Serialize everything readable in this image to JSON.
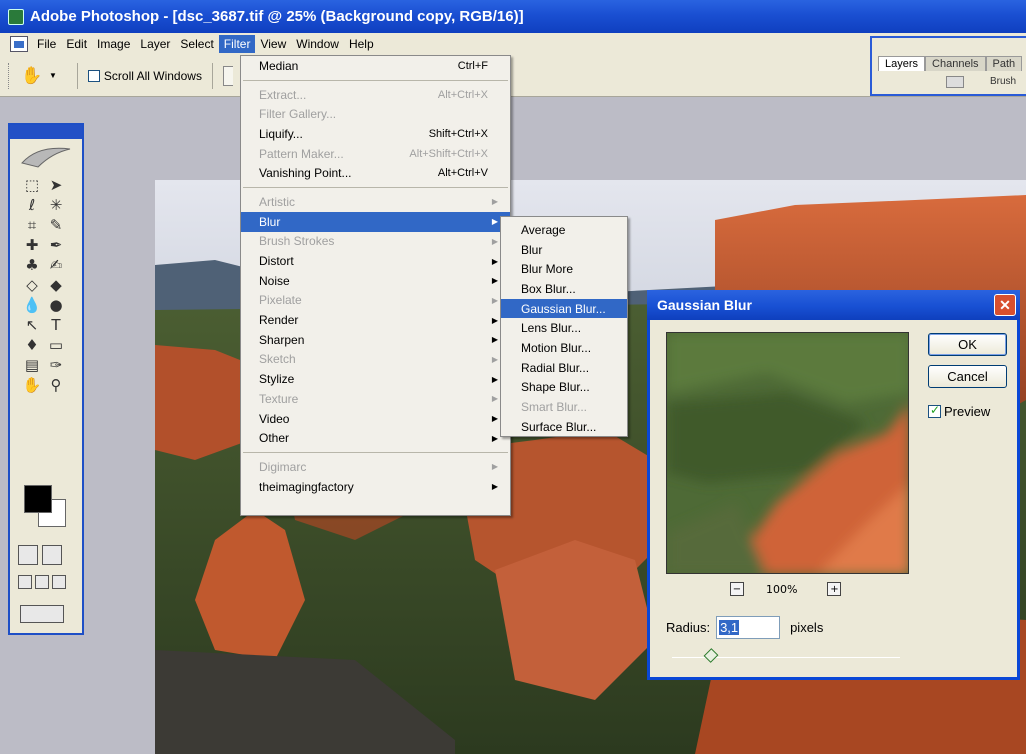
{
  "window": {
    "title": "Adobe Photoshop - [dsc_3687.tif @ 25% (Background copy, RGB/16)]"
  },
  "menubar": {
    "items": [
      "File",
      "Edit",
      "Image",
      "Layer",
      "Select",
      "Filter",
      "View",
      "Window",
      "Help"
    ],
    "active": "Filter"
  },
  "options_bar": {
    "scroll_all_windows_label": "Scroll All Windows",
    "scroll_all_windows_checked": false
  },
  "palette_well": {
    "tabs": [
      "Layers",
      "Channels",
      "Path"
    ],
    "brush_label": "Brush"
  },
  "filter_menu": {
    "groups": [
      [
        {
          "label": "Median",
          "shortcut": "Ctrl+F",
          "disabled": false,
          "submenu": false
        }
      ],
      [
        {
          "label": "Extract...",
          "shortcut": "Alt+Ctrl+X",
          "disabled": true,
          "submenu": false
        },
        {
          "label": "Filter Gallery...",
          "shortcut": "",
          "disabled": true,
          "submenu": false
        },
        {
          "label": "Liquify...",
          "shortcut": "Shift+Ctrl+X",
          "disabled": false,
          "submenu": false
        },
        {
          "label": "Pattern Maker...",
          "shortcut": "Alt+Shift+Ctrl+X",
          "disabled": true,
          "submenu": false
        },
        {
          "label": "Vanishing Point...",
          "shortcut": "Alt+Ctrl+V",
          "disabled": false,
          "submenu": false
        }
      ],
      [
        {
          "label": "Artistic",
          "disabled": true,
          "submenu": true
        },
        {
          "label": "Blur",
          "disabled": false,
          "submenu": true,
          "highlighted": true
        },
        {
          "label": "Brush Strokes",
          "disabled": true,
          "submenu": true
        },
        {
          "label": "Distort",
          "disabled": false,
          "submenu": true
        },
        {
          "label": "Noise",
          "disabled": false,
          "submenu": true
        },
        {
          "label": "Pixelate",
          "disabled": true,
          "submenu": true
        },
        {
          "label": "Render",
          "disabled": false,
          "submenu": true
        },
        {
          "label": "Sharpen",
          "disabled": false,
          "submenu": true
        },
        {
          "label": "Sketch",
          "disabled": true,
          "submenu": true
        },
        {
          "label": "Stylize",
          "disabled": false,
          "submenu": true
        },
        {
          "label": "Texture",
          "disabled": true,
          "submenu": true
        },
        {
          "label": "Video",
          "disabled": false,
          "submenu": true
        },
        {
          "label": "Other",
          "disabled": false,
          "submenu": true
        }
      ],
      [
        {
          "label": "Digimarc",
          "disabled": true,
          "submenu": true
        },
        {
          "label": "theimagingfactory",
          "disabled": false,
          "submenu": true
        }
      ]
    ]
  },
  "blur_submenu": {
    "items": [
      {
        "label": "Average",
        "disabled": false
      },
      {
        "label": "Blur",
        "disabled": false
      },
      {
        "label": "Blur More",
        "disabled": false
      },
      {
        "label": "Box Blur...",
        "disabled": false
      },
      {
        "label": "Gaussian Blur...",
        "disabled": false,
        "highlighted": true
      },
      {
        "label": "Lens Blur...",
        "disabled": false
      },
      {
        "label": "Motion Blur...",
        "disabled": false
      },
      {
        "label": "Radial Blur...",
        "disabled": false
      },
      {
        "label": "Shape Blur...",
        "disabled": false
      },
      {
        "label": "Smart Blur...",
        "disabled": true
      },
      {
        "label": "Surface Blur...",
        "disabled": false
      }
    ]
  },
  "gaussian_dialog": {
    "title": "Gaussian Blur",
    "ok_label": "OK",
    "cancel_label": "Cancel",
    "preview_label": "Preview",
    "preview_checked": true,
    "zoom_level": "100%",
    "radius_label": "Radius:",
    "radius_value": "3,1",
    "radius_units": "pixels"
  },
  "colors": {
    "title_blue": "#1a4fd2",
    "menu_highlight": "#3168c6",
    "menu_bg": "#f2f0ea",
    "chrome_bg": "#ece9d8",
    "workspace_bg": "#bcbcc6",
    "close_red": "#d8502f"
  }
}
